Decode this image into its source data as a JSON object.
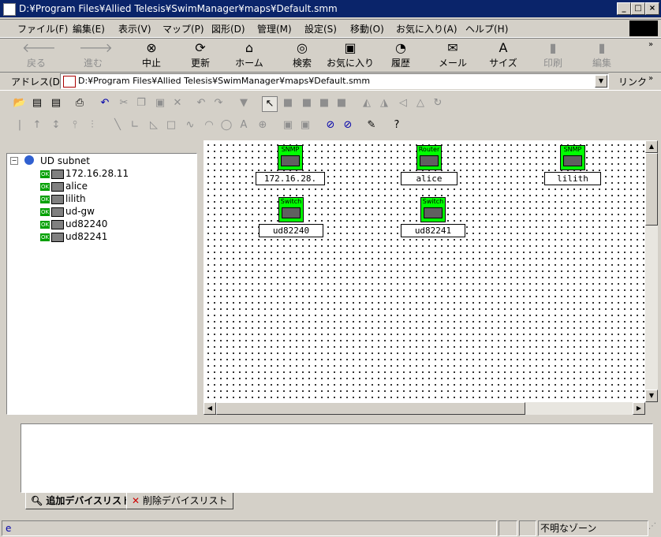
{
  "window": {
    "title": "D:¥Program Files¥Allied Telesis¥SwimManager¥maps¥Default.smm"
  },
  "menu": [
    "ファイル(F)",
    "編集(E)",
    "表示(V)",
    "マップ(P)",
    "図形(D)",
    "管理(M)",
    "設定(S)",
    "移動(O)",
    "お気に入り(A)",
    "ヘルプ(H)"
  ],
  "toolbar": {
    "back": "戻る",
    "forward": "進む",
    "stop": "中止",
    "refresh": "更新",
    "home": "ホーム",
    "search": "検索",
    "favorites": "お気に入り",
    "history": "履歴",
    "mail": "メール",
    "size": "サイズ",
    "print": "印刷",
    "edit": "編集"
  },
  "address": {
    "label": "アドレス(D)",
    "value": "D:¥Program Files¥Allied Telesis¥SwimManager¥maps¥Default.smm",
    "links": "リンク"
  },
  "tree": {
    "root": "UD subnet",
    "items": [
      {
        "status": "OK",
        "label": "172.16.28.11"
      },
      {
        "status": "OK",
        "label": "alice"
      },
      {
        "status": "OK",
        "label": "lilith"
      },
      {
        "status": "OK",
        "label": "ud-gw"
      },
      {
        "status": "OK",
        "label": "ud82240"
      },
      {
        "status": "OK",
        "label": "ud82241"
      }
    ]
  },
  "map": {
    "nodes": [
      {
        "type": "SNMP",
        "label": "172.16.28."
      },
      {
        "type": "Router",
        "label": "alice"
      },
      {
        "type": "SNMP",
        "label": "lilith"
      },
      {
        "type": "Switch",
        "label": "ud82240"
      },
      {
        "type": "Switch",
        "label": "ud82241"
      }
    ]
  },
  "tabs": {
    "added": "追加デバイスリスト",
    "deleted": "削除デバイスリスト"
  },
  "status": {
    "zone": "不明なゾーン"
  },
  "colors": {
    "titlebar": "#0a246a",
    "node": "#00ff00"
  }
}
